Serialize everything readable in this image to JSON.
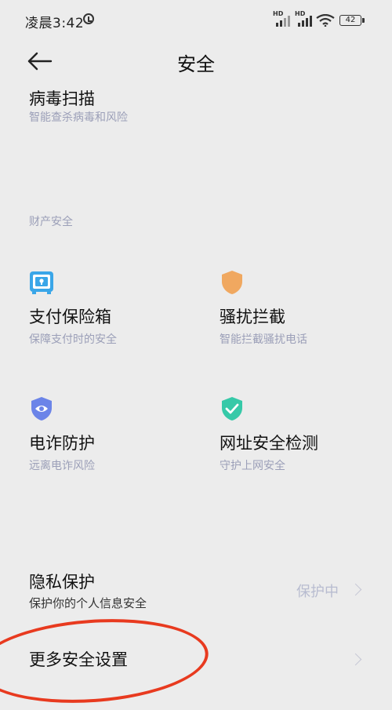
{
  "status_bar": {
    "time": "凌晨3:42",
    "sim1_label": "HD",
    "sim2_label": "HD",
    "battery": "42",
    "icons": [
      "alarm-icon",
      "signal-icon",
      "signal-icon",
      "wifi-icon",
      "battery-icon"
    ]
  },
  "header": {
    "title": "安全",
    "back_icon": "arrow-left-icon"
  },
  "virus_scan": {
    "title": "病毒扫描",
    "subtitle": "智能查杀病毒和风险"
  },
  "property_section": {
    "label": "财产安全",
    "items": [
      {
        "title": "支付保险箱",
        "subtitle": "保障支付时的安全",
        "icon": "safe-box-icon",
        "icon_color": "#3aa6e8"
      },
      {
        "title": "骚扰拦截",
        "subtitle": "智能拦截骚扰电话",
        "icon": "shield-icon",
        "icon_color": "#f0a860"
      },
      {
        "title": "电诈防护",
        "subtitle": "远离电诈风险",
        "icon": "shield-eye-icon",
        "icon_color": "#6b84e8"
      },
      {
        "title": "网址安全检测",
        "subtitle": "守护上网安全",
        "icon": "shield-check-icon",
        "icon_color": "#36c9a8"
      }
    ]
  },
  "privacy": {
    "title": "隐私保护",
    "subtitle": "保护你的个人信息安全",
    "status": "保护中"
  },
  "more": {
    "title": "更多安全设置"
  },
  "annotation_color": "#e83a1f"
}
